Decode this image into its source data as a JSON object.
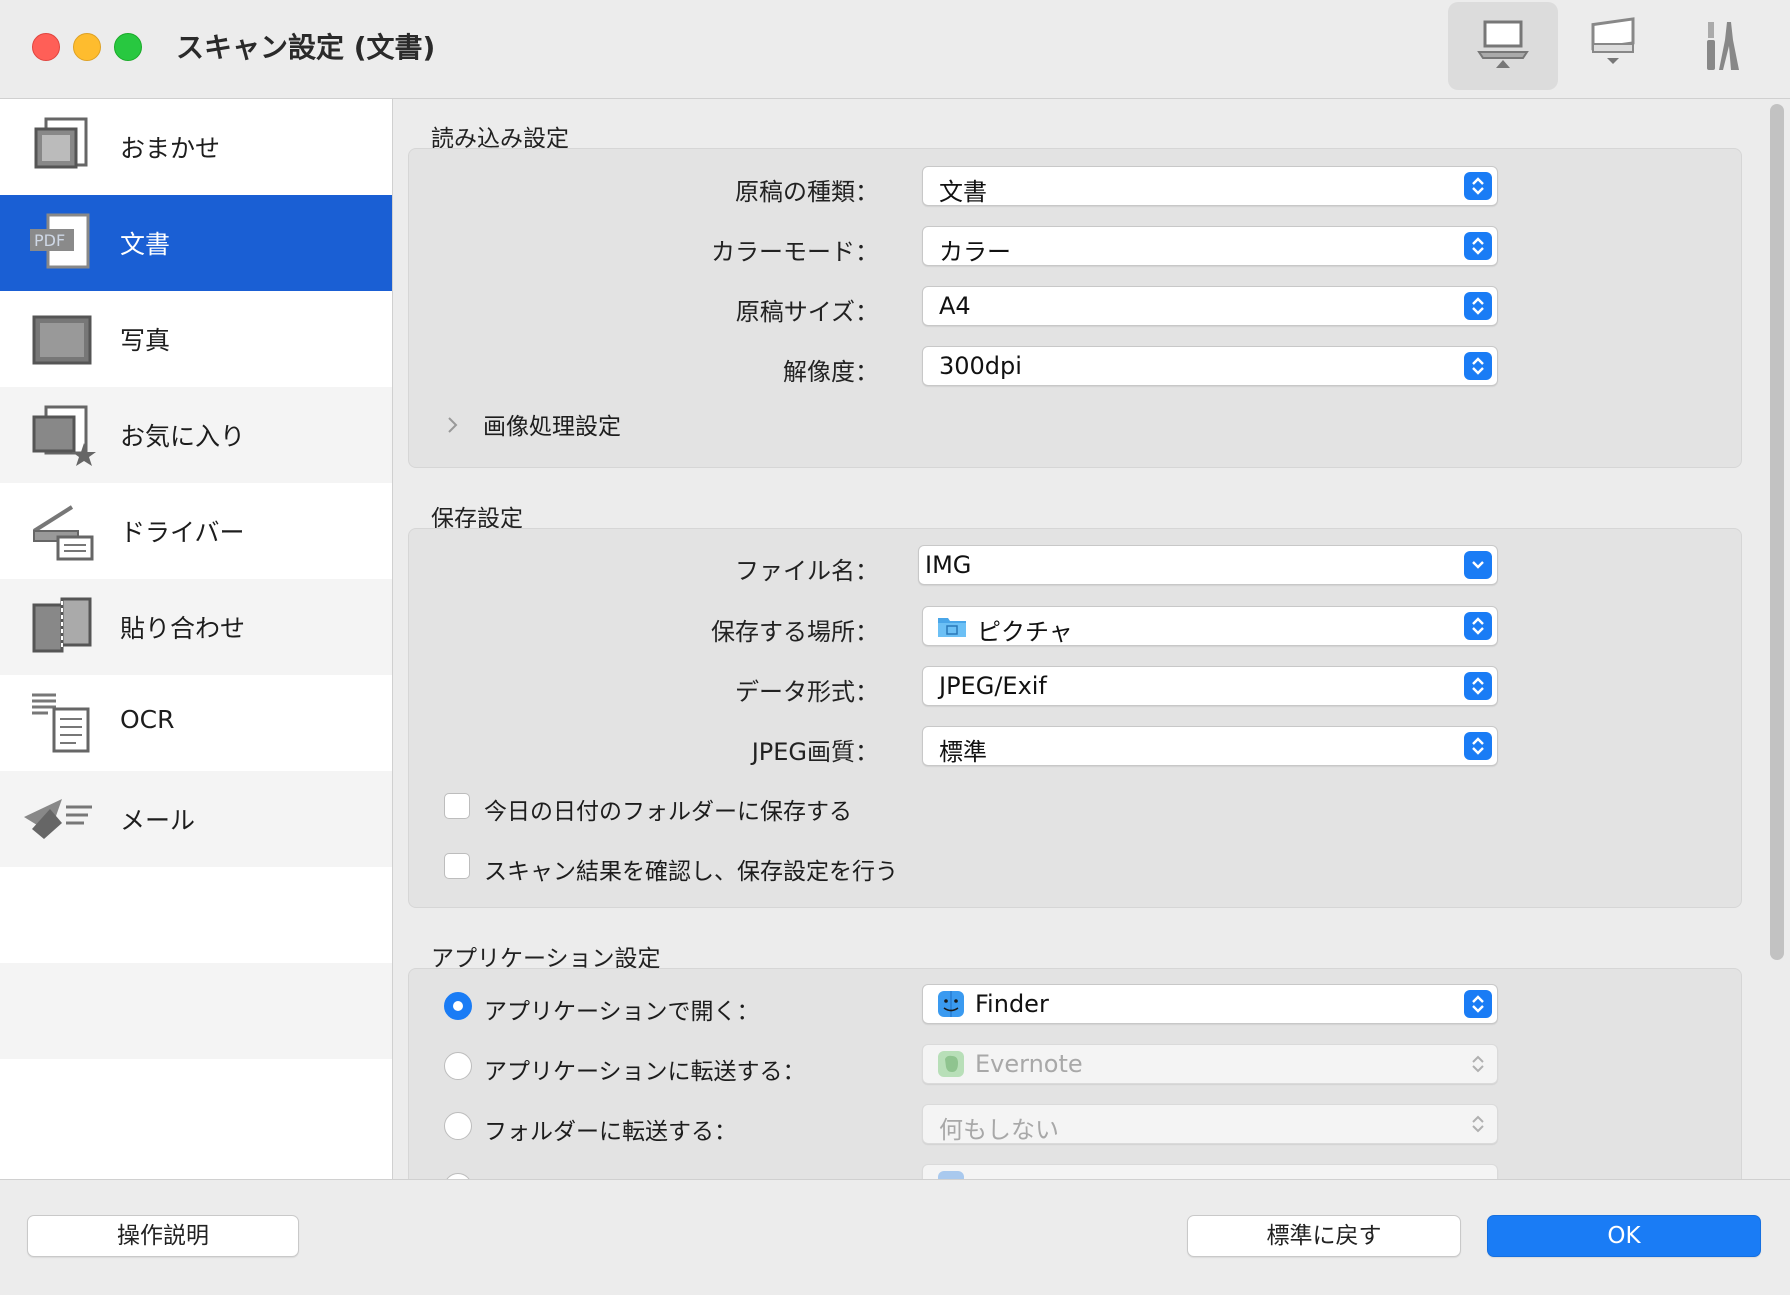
{
  "window": {
    "title": "スキャン設定 (文書)"
  },
  "toolbar": {
    "items": [
      {
        "name": "scan-from-computer",
        "icon": "computer-scan-icon",
        "active": true
      },
      {
        "name": "scan-from-operation-panel",
        "icon": "scanner-icon",
        "active": false
      },
      {
        "name": "general-settings",
        "icon": "tools-icon",
        "active": false
      }
    ]
  },
  "sidebar": {
    "items": [
      {
        "label": "おまかせ",
        "icon": "auto-scan-icon"
      },
      {
        "label": "文書",
        "icon": "pdf-document-icon",
        "selected": true
      },
      {
        "label": "写真",
        "icon": "photo-icon"
      },
      {
        "label": "お気に入り",
        "icon": "favorites-icon"
      },
      {
        "label": "ドライバー",
        "icon": "driver-icon"
      },
      {
        "label": "貼り合わせ",
        "icon": "stitch-icon"
      },
      {
        "label": "OCR",
        "icon": "ocr-icon"
      },
      {
        "label": "メール",
        "icon": "mail-icon"
      }
    ]
  },
  "scan_settings": {
    "title": "読み込み設定",
    "rows": [
      {
        "label": "原稿の種類：",
        "value": "文書"
      },
      {
        "label": "カラーモード：",
        "value": "カラー"
      },
      {
        "label": "原稿サイズ：",
        "value": "A4"
      },
      {
        "label": "解像度：",
        "value": "300dpi"
      }
    ],
    "image_processing": "画像処理設定"
  },
  "save_settings": {
    "title": "保存設定",
    "file_name_label": "ファイル名：",
    "file_name_value": "IMG",
    "location_label": "保存する場所：",
    "location_value": "ピクチャ",
    "format_label": "データ形式：",
    "format_value": "JPEG/Exif",
    "quality_label": "JPEG画質：",
    "quality_value": "標準",
    "checkbox_date_folder": "今日の日付のフォルダーに保存する",
    "checkbox_confirm": "スキャン結果を確認し、保存設定を行う"
  },
  "app_settings": {
    "title": "アプリケーション設定",
    "options": [
      {
        "label": "アプリケーションで開く：",
        "value": "Finder",
        "selected": true,
        "enabled": true
      },
      {
        "label": "アプリケーションに転送する：",
        "value": "Evernote",
        "selected": false,
        "enabled": false
      },
      {
        "label": "フォルダーに転送する：",
        "value": "何もしない",
        "selected": false,
        "enabled": false
      }
    ]
  },
  "footer": {
    "help": "操作説明",
    "defaults": "標準に戻す",
    "ok": "OK"
  },
  "colors": {
    "accent": "#1a7cf5",
    "sidebar_selected": "#1a5fd4"
  }
}
